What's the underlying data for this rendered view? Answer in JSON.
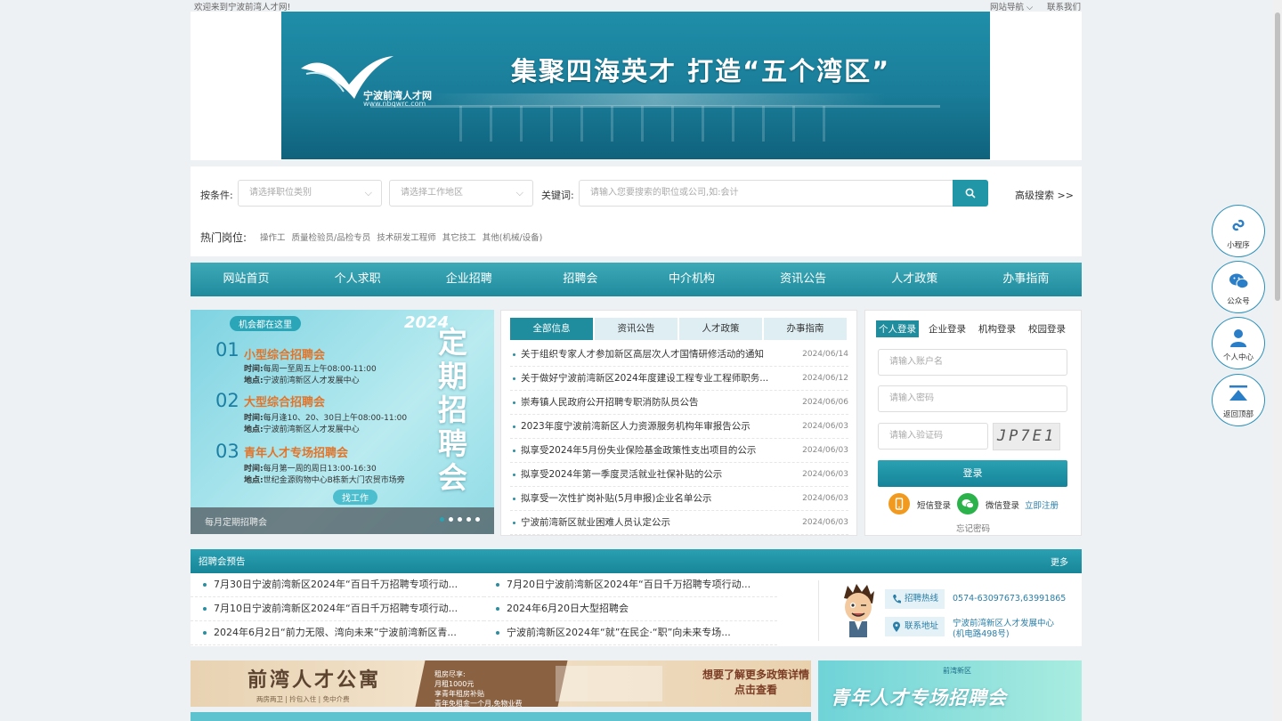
{
  "topbar": {
    "welcome": "欢迎来到宁波前湾人才网!",
    "site_nav": "网站导航",
    "contact": "联系我们"
  },
  "banner": {
    "logo_name": "宁波前湾人才网",
    "logo_url": "www.nbqwrc.com",
    "slogan": "集聚四海英才  打造“五个湾区”"
  },
  "search": {
    "condition_label": "按条件:",
    "job_type_placeholder": "请选择职位类别",
    "area_placeholder": "请选择工作地区",
    "keyword_label": "关键词:",
    "keyword_placeholder": "请输入您要搜索的职位或公司,如:会计",
    "advanced": "高级搜索 >>",
    "hot_label": "热门岗位:",
    "hot_items": [
      "操作工",
      "质量检验员/品检专员",
      "技术研发工程师",
      "其它技工",
      "其他(机械/设备)"
    ]
  },
  "nav": [
    "网站首页",
    "个人求职",
    "企业招聘",
    "招聘会",
    "中介机构",
    "资讯公告",
    "人才政策",
    "办事指南"
  ],
  "slide": {
    "tag": "机会都在这里",
    "year": "2024",
    "big_title": "定期招聘会",
    "items": [
      {
        "num": "01",
        "title": "小型综合招聘会",
        "time_label": "时间:",
        "time": "每周一至周五上午08:00-11:00",
        "place_label": "地点:",
        "place": "宁波前湾新区人才发展中心"
      },
      {
        "num": "02",
        "title": "大型综合招聘会",
        "time_label": "时间:",
        "time": "每月逢10、20、30日上午08:00-11:00",
        "place_label": "地点:",
        "place": "宁波前湾新区人才发展中心"
      },
      {
        "num": "03",
        "title": "青年人才专场招聘会",
        "time_label": "时间:",
        "time": "每月第一周的周日13:00-16:30",
        "place_label": "地点:",
        "place": "世纪金源购物中心B栋新大门农贸市场旁"
      }
    ],
    "find_job": "找工作",
    "caption": "每月定期招聘会",
    "slides_total": 5,
    "slides_active": 1
  },
  "news": {
    "tabs": [
      "全部信息",
      "资讯公告",
      "人才政策",
      "办事指南"
    ],
    "items": [
      {
        "title": "关于组织专家人才参加新区高层次人才国情研修活动的通知",
        "date": "2024/06/14"
      },
      {
        "title": "关于做好宁波前湾新区2024年度建设工程专业工程师职务...",
        "date": "2024/06/12"
      },
      {
        "title": "崇寿镇人民政府公开招聘专职消防队员公告",
        "date": "2024/06/06"
      },
      {
        "title": "2023年度宁波前湾新区人力资源服务机构年审报告公示",
        "date": "2024/06/03"
      },
      {
        "title": "拟享受2024年5月份失业保险基金政策性支出项目的公示",
        "date": "2024/06/03"
      },
      {
        "title": "拟享受2024年第一季度灵活就业社保补贴的公示",
        "date": "2024/06/03"
      },
      {
        "title": "拟享受一次性扩岗补贴(5月申报)企业名单公示",
        "date": "2024/06/03"
      },
      {
        "title": "宁波前湾新区就业困难人员认定公示",
        "date": "2024/06/03"
      }
    ]
  },
  "login": {
    "tabs": [
      "个人登录",
      "企业登录",
      "机构登录",
      "校园登录"
    ],
    "username_placeholder": "请输入账户名",
    "password_placeholder": "请输入密码",
    "captcha_placeholder": "请输入验证码",
    "captcha_text": "JP7E1",
    "login_button": "登录",
    "sms_login": "短信登录",
    "wechat_login": "微信登录",
    "register": "立即注册",
    "forgot": "忘记密码"
  },
  "side": [
    "小程序",
    "公众号",
    "个人中心",
    "返回顶部"
  ],
  "recruit": {
    "title": "招聘会预告",
    "more": "更多",
    "left": [
      "7月30日宁波前湾新区2024年“百日千万招聘专项行动...",
      "7月10日宁波前湾新区2024年“百日千万招聘专项行动...",
      "2024年6月2日“前力无限、湾向未来”宁波前湾新区青..."
    ],
    "right": [
      "7月20日宁波前湾新区2024年“百日千万招聘专项行动...",
      "2024年6月20日大型招聘会",
      "宁波前湾新区2024年“就”在民企·“职”向未来专场..."
    ],
    "hotline_label": "招聘热线",
    "hotline": "0574-63097673,63991865",
    "address_label": "联系地址",
    "address": "宁波前湾新区人才发展中心",
    "address2": "(机电路498号)"
  },
  "ads": {
    "apt_title": "前湾人才公寓",
    "apt_sub": "两房两卫 | 拎包入住 | 免中介费",
    "apt_promo_title": "租房尽享:",
    "apt_promo_lines": [
      "月租1000元",
      "享青年租房补贴",
      "青年免租金一个月,免物业费"
    ],
    "policy_cta": "想要了解更多政策详情",
    "policy_cta2": "点击查看",
    "youth_brand": "前湾新区",
    "youth_title": "青年人才专场招聘会"
  },
  "colors": {
    "accent": "#1f8d9d",
    "link": "#2a7ea7",
    "date": "#888888"
  }
}
